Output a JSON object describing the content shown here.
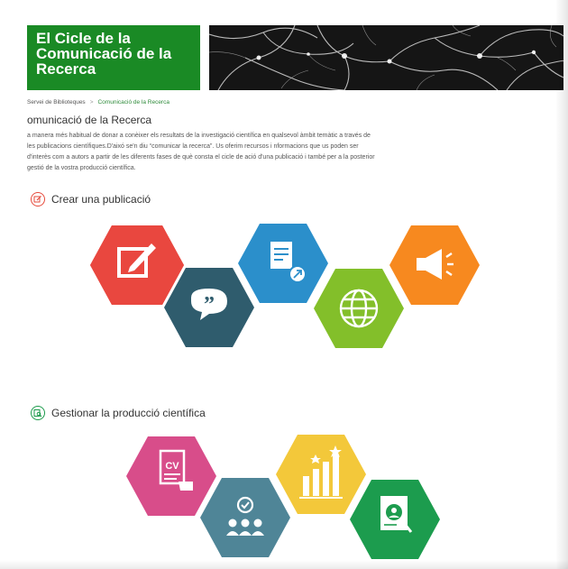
{
  "header": {
    "title": "El Cicle de la Comunicació de la Recerca"
  },
  "breadcrumb": {
    "root": "Servei de Biblioteques",
    "separator": ">",
    "current": "Comunicació de la Recerca"
  },
  "page_title": "omunicació de la Recerca",
  "intro": "a manera més habitual de donar a conèixer els resultats de la investigació científica en qualsevol àmbit temàtic a través de les publicacions científiques.D'aixó se'n diu “comunicar la recerca”. Us oferim recursos i nformacions que us poden ser d'interès com a autors a partir de les diferents fases de què consta el cicle de ació d'una publicació i també per a la posterior gestió de la vostra producció científica.",
  "sections": [
    {
      "label": "Crear una publicació",
      "icon": "edit-icon",
      "color": "#e64b3c",
      "hexes": [
        {
          "icon": "edit-icon",
          "color": "#e9473f"
        },
        {
          "icon": "quote-icon",
          "color": "#2f5c6d"
        },
        {
          "icon": "document-share-icon",
          "color": "#2b8fcb"
        },
        {
          "icon": "globe-icon",
          "color": "#83bf2a"
        },
        {
          "icon": "megaphone-icon",
          "color": "#f7891f"
        }
      ]
    },
    {
      "label": "Gestionar la producció científica",
      "icon": "search-doc-icon",
      "color": "#1a9a4a",
      "hexes": [
        {
          "icon": "cv-icon",
          "color": "#d84d8a"
        },
        {
          "icon": "people-icon",
          "color": "#4f8597"
        },
        {
          "icon": "bar-chart-icon",
          "color": "#f3c83a"
        },
        {
          "icon": "profile-search-icon",
          "color": "#1c9c4e"
        }
      ]
    }
  ],
  "cv_text": "CV"
}
